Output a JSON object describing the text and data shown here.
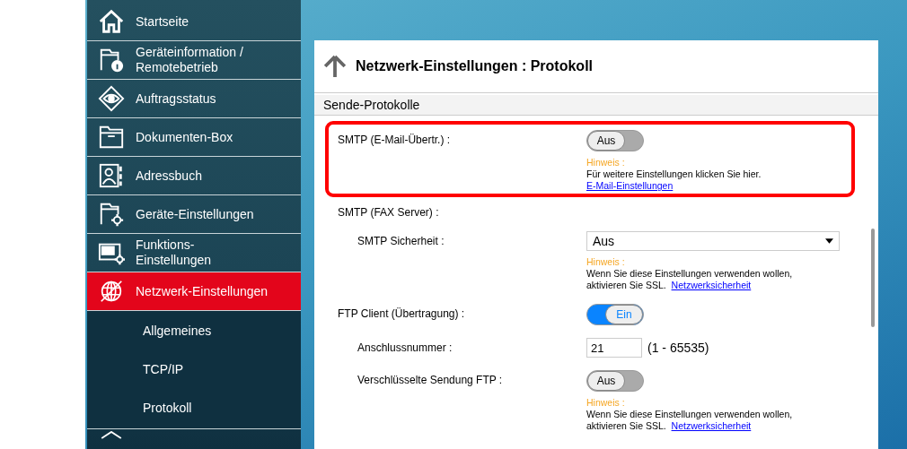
{
  "sidebar": {
    "items": [
      {
        "label": "Startseite",
        "selected": false
      },
      {
        "label": "Geräteinformation /\nRemotebetrieb",
        "selected": false
      },
      {
        "label": "Auftragsstatus",
        "selected": false
      },
      {
        "label": "Dokumenten-Box",
        "selected": false
      },
      {
        "label": "Adressbuch",
        "selected": false
      },
      {
        "label": "Geräte-Einstellungen",
        "selected": false
      },
      {
        "label": "Funktions-\nEinstellungen",
        "selected": false
      },
      {
        "label": "Netzwerk-Einstellungen",
        "selected": true,
        "children": [
          {
            "label": "Allgemeines"
          },
          {
            "label": "TCP/IP"
          },
          {
            "label": "Protokoll"
          }
        ]
      },
      {
        "selected": false
      }
    ]
  },
  "page": {
    "title": "Netzwerk-Einstellungen : Protokoll",
    "section": "Sende-Protokolle",
    "rows": [
      {
        "kind": "toggle",
        "label": "SMTP (E-Mail-Übertr.) :",
        "indent": false,
        "on": false,
        "value": "Aus",
        "highlighted": true,
        "hint": {
          "title": "Hinweis :",
          "text": "Für weitere Einstellungen klicken Sie hier.",
          "link": "E-Mail-Einstellungen"
        }
      },
      {
        "kind": "heading",
        "label": "SMTP (FAX Server) :",
        "indent": false
      },
      {
        "kind": "select",
        "label": "SMTP Sicherheit :",
        "indent": true,
        "value": "Aus",
        "hint": {
          "title": "Hinweis :",
          "text": "Wenn Sie diese Einstellungen verwenden wollen, aktivieren Sie SSL.",
          "link": "Netzwerksicherheit"
        }
      },
      {
        "kind": "toggle",
        "label": "FTP Client (Übertragung) :",
        "indent": false,
        "on": true,
        "value": "Ein"
      },
      {
        "kind": "input",
        "label": "Anschlussnummer :",
        "indent": true,
        "value": "21",
        "range": "(1 - 65535)"
      },
      {
        "kind": "toggle",
        "label": "Verschlüsselte Sendung FTP :",
        "indent": true,
        "on": false,
        "value": "Aus",
        "hint": {
          "title": "Hinweis :",
          "text": "Wenn Sie diese Einstellungen verwenden wollen, aktivieren Sie SSL.",
          "link": "Netzwerksicherheit"
        }
      }
    ]
  }
}
